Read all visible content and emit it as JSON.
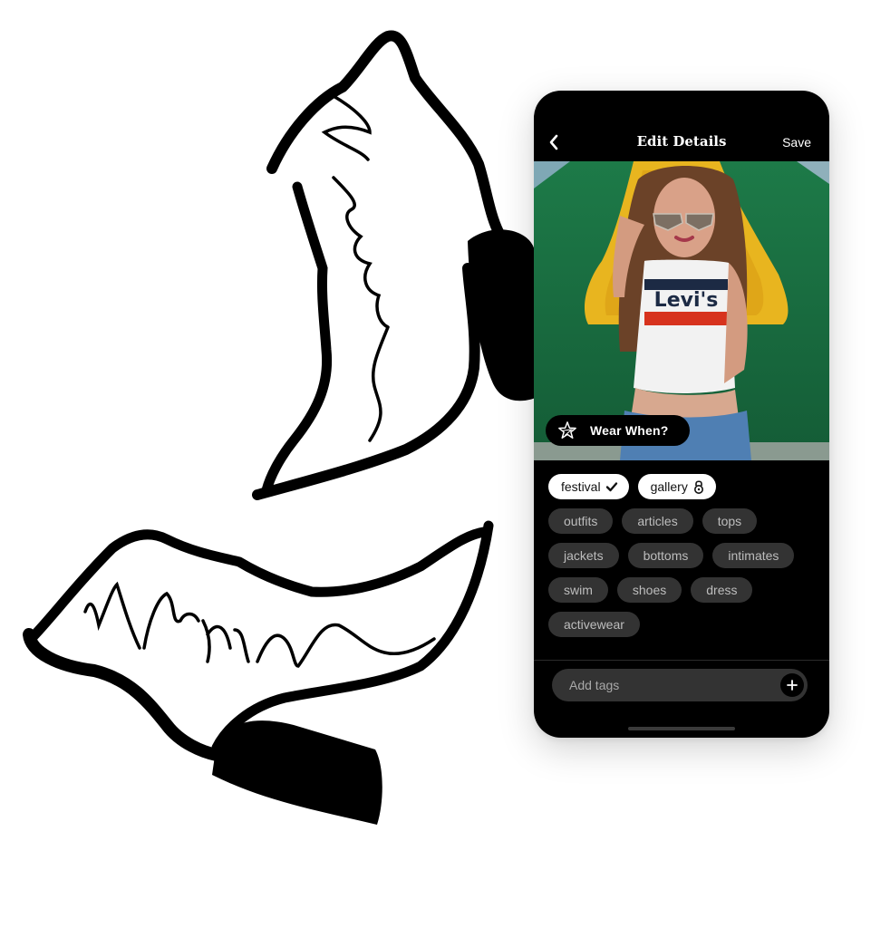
{
  "app": {
    "header": {
      "title": "Edit Details",
      "back_icon": "chevron-left-icon",
      "save_label": "Save"
    },
    "photo": {
      "description": "Woman wearing sunglasses and a Levi's crop top with flower bed behind",
      "shirt_logo_text": "Levi's",
      "wear_when": {
        "icon": "star-icon",
        "label": "Wear When?"
      }
    },
    "selected_tags": [
      {
        "label": "festival",
        "icon": "checkmark-icon"
      },
      {
        "label": "gallery",
        "icon": "lock-icon"
      }
    ],
    "suggested_tags": [
      [
        "outfits",
        "articles",
        "tops"
      ],
      [
        "jackets",
        "bottoms",
        "intimates"
      ],
      [
        "swim",
        "shoes",
        "dress"
      ],
      [
        "activewear"
      ]
    ],
    "add_tags": {
      "value": "",
      "placeholder": "Add tags",
      "button_icon": "plus-icon"
    }
  },
  "colors": {
    "phone_bg": "#000000",
    "chip_dark": "#333333",
    "chip_text": "#bdbdbd",
    "chip_selected": "#ffffff"
  },
  "illustrations": [
    "ankle-boot-upright",
    "ankle-boot-sideways"
  ]
}
